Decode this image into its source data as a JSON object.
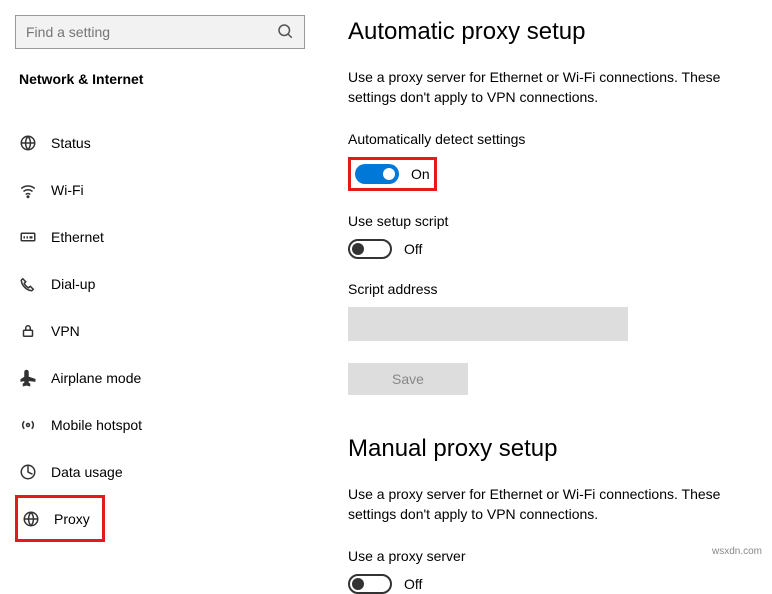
{
  "search": {
    "placeholder": "Find a setting"
  },
  "section_title": "Network & Internet",
  "sidebar": {
    "items": [
      {
        "label": "Status"
      },
      {
        "label": "Wi-Fi"
      },
      {
        "label": "Ethernet"
      },
      {
        "label": "Dial-up"
      },
      {
        "label": "VPN"
      },
      {
        "label": "Airplane mode"
      },
      {
        "label": "Mobile hotspot"
      },
      {
        "label": "Data usage"
      },
      {
        "label": "Proxy"
      }
    ]
  },
  "auto": {
    "heading": "Automatic proxy setup",
    "desc": "Use a proxy server for Ethernet or Wi-Fi connections. These settings don't apply to VPN connections.",
    "detect_label": "Automatically detect settings",
    "detect_state": "On",
    "script_label": "Use setup script",
    "script_state": "Off",
    "address_label": "Script address",
    "save_label": "Save"
  },
  "manual": {
    "heading": "Manual proxy setup",
    "desc": "Use a proxy server for Ethernet or Wi-Fi connections. These settings don't apply to VPN connections.",
    "use_label": "Use a proxy server",
    "use_state": "Off"
  },
  "watermark": "wsxdn.com"
}
